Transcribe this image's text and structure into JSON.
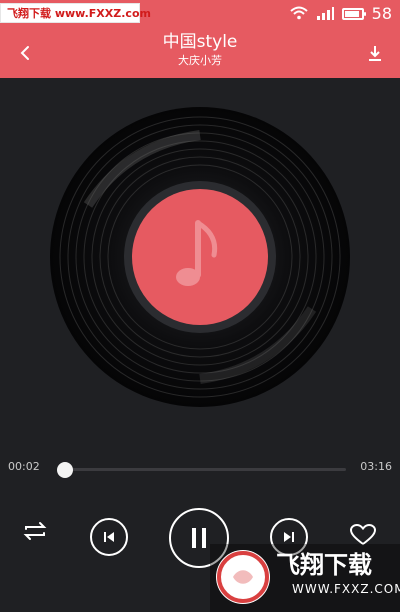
{
  "status_bar": {
    "watermark_text": "飞翔下载 www.FXXZ.com",
    "battery_level": "58",
    "icons": [
      "wifi-icon",
      "signal-icon",
      "battery-icon"
    ]
  },
  "header": {
    "title": "中国style",
    "subtitle": "大庆小芳"
  },
  "player": {
    "current_time": "00:02",
    "total_time": "03:16",
    "progress": 0.01,
    "accent_color": "#e65a61",
    "controls": [
      "repeat-icon",
      "previous-icon",
      "pause-icon",
      "next-icon",
      "heart-icon"
    ]
  },
  "watermark_bottom": {
    "brand_text": "飞翔下载",
    "url_text": "WWW.FXXZ.COM"
  }
}
